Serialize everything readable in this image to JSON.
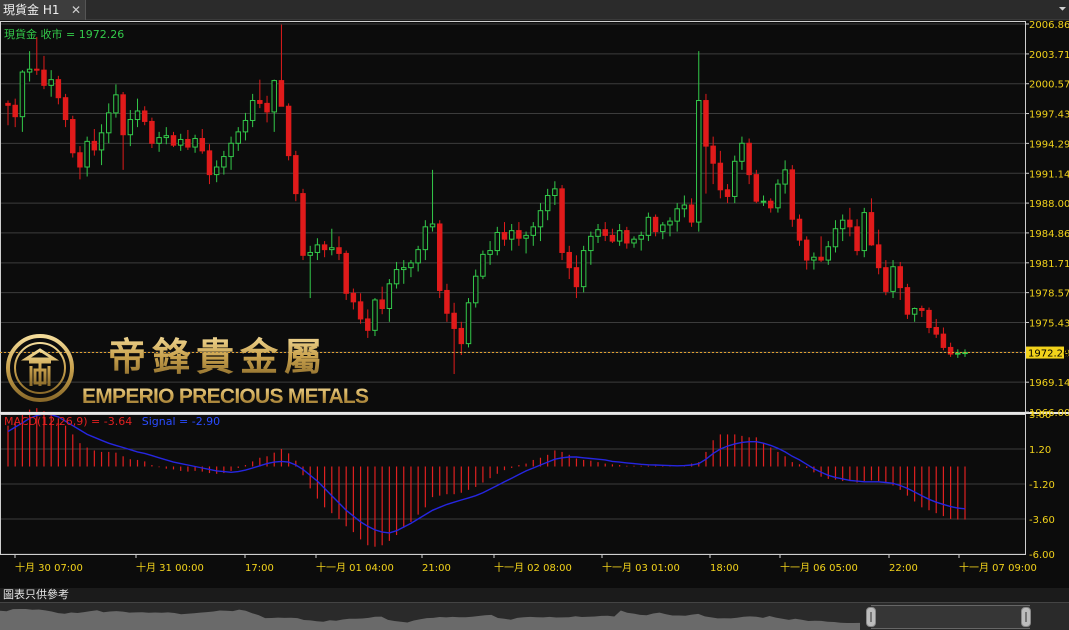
{
  "tab": {
    "title": "現貨金 H1",
    "close_glyph": "✕",
    "menu_glyph": "⏷"
  },
  "price_label": "現貨金 收市 = 1972.26",
  "macd_label": {
    "macd": "MACD(12,26,9) = -3.64",
    "signal": "Signal = -2.90"
  },
  "logo": {
    "chinese": "帝鋒貴金屬",
    "english": "EMPERIO PRECIOUS METALS"
  },
  "last_price": "1972.26",
  "price_ticks": [
    "2006.86",
    "2003.71",
    "2000.57",
    "1997.43",
    "1994.29",
    "1991.14",
    "1988.00",
    "1984.86",
    "1981.71",
    "1978.57",
    "1975.43",
    "1972.29",
    "1969.14",
    "1966.00"
  ],
  "macd_ticks": [
    "3.60",
    "1.20",
    "-1.20",
    "-3.60",
    "-6.00"
  ],
  "time_ticks": [
    "十月 30 07:00",
    "十月 31 00:00",
    "17:00",
    "十一月 01 04:00",
    "21:00",
    "十一月 02 08:00",
    "十一月 03 01:00",
    "18:00",
    "十一月 06 05:00",
    "22:00",
    "十一月 07 09:00"
  ],
  "footer_note": "圖表只供參考",
  "colors": {
    "up": "#33c94a",
    "down": "#e01b1b",
    "price_axis": "#f2d21b",
    "macd_hist": "#e02020",
    "signal": "#2626e0",
    "label_green": "#33c94a",
    "logo_gold": "#c9a95a"
  },
  "chart_data": {
    "type": "candlestick",
    "ylim": [
      1966.0,
      2006.86
    ],
    "macd_ylim": [
      -6.0,
      3.6
    ],
    "last": 1972.26,
    "candles": [
      [
        1998.5,
        1998.8,
        1996.2,
        1998.3
      ],
      [
        1998.3,
        1999.0,
        1996.0,
        1997.1
      ],
      [
        1997.1,
        2002.0,
        1995.5,
        2001.8
      ],
      [
        2001.8,
        2004.0,
        2000.8,
        2002.1
      ],
      [
        2002.1,
        2005.5,
        2001.5,
        2002.0
      ],
      [
        2002.0,
        2003.5,
        2000.0,
        2000.4
      ],
      [
        2000.4,
        2002.0,
        1999.2,
        2001.0
      ],
      [
        2001.0,
        2001.4,
        1998.4,
        1999.1
      ],
      [
        1999.1,
        1999.5,
        1996.0,
        1996.8
      ],
      [
        1996.8,
        1997.2,
        1992.8,
        1993.3
      ],
      [
        1993.3,
        1994.0,
        1990.5,
        1991.8
      ],
      [
        1991.8,
        1995.0,
        1990.8,
        1994.5
      ],
      [
        1994.5,
        1995.8,
        1993.0,
        1993.6
      ],
      [
        1993.6,
        1996.3,
        1992.0,
        1995.4
      ],
      [
        1995.4,
        1998.5,
        1994.3,
        1997.5
      ],
      [
        1997.5,
        2000.5,
        1997.0,
        1999.4
      ],
      [
        1999.4,
        1999.7,
        1991.5,
        1995.2
      ],
      [
        1995.2,
        1997.8,
        1994.0,
        1996.8
      ],
      [
        1996.8,
        1999.0,
        1996.0,
        1997.7
      ],
      [
        1997.7,
        1998.2,
        1996.2,
        1996.6
      ],
      [
        1996.6,
        1997.0,
        1993.8,
        1994.3
      ],
      [
        1994.3,
        1995.5,
        1993.4,
        1994.9
      ],
      [
        1994.9,
        1996.0,
        1994.2,
        1995.1
      ],
      [
        1995.1,
        1995.5,
        1993.9,
        1994.1
      ],
      [
        1994.1,
        1995.3,
        1993.5,
        1994.7
      ],
      [
        1994.7,
        1995.7,
        1993.6,
        1993.9
      ],
      [
        1993.9,
        1995.2,
        1993.3,
        1994.8
      ],
      [
        1994.8,
        1995.8,
        1993.2,
        1993.5
      ],
      [
        1993.5,
        1994.2,
        1990.0,
        1991.0
      ],
      [
        1991.0,
        1992.5,
        1990.2,
        1991.8
      ],
      [
        1991.8,
        1993.5,
        1991.0,
        1992.9
      ],
      [
        1992.9,
        1995.0,
        1991.5,
        1994.3
      ],
      [
        1994.3,
        1996.0,
        1993.5,
        1995.5
      ],
      [
        1995.5,
        1997.5,
        1994.6,
        1996.7
      ],
      [
        1996.7,
        1999.5,
        1996.0,
        1998.8
      ],
      [
        1998.8,
        2001.0,
        1998.0,
        1998.5
      ],
      [
        1998.5,
        1999.3,
        1996.5,
        1997.6
      ],
      [
        1997.6,
        2001.0,
        1995.5,
        2000.9
      ],
      [
        2000.9,
        2006.8,
        1999.6,
        1998.2
      ],
      [
        1998.2,
        1998.5,
        1992.5,
        1993.0
      ],
      [
        1993.0,
        1993.5,
        1988.2,
        1989.0
      ],
      [
        1989.0,
        1989.5,
        1982.0,
        1982.5
      ],
      [
        1982.5,
        1983.5,
        1978.0,
        1982.8
      ],
      [
        1982.8,
        1984.3,
        1982.0,
        1983.6
      ],
      [
        1983.6,
        1984.0,
        1982.3,
        1983.1
      ],
      [
        1983.1,
        1985.3,
        1982.5,
        1983.3
      ],
      [
        1983.3,
        1984.5,
        1982.0,
        1982.7
      ],
      [
        1982.7,
        1983.0,
        1977.8,
        1978.5
      ],
      [
        1978.5,
        1979.0,
        1976.8,
        1977.6
      ],
      [
        1977.6,
        1978.5,
        1975.3,
        1975.8
      ],
      [
        1975.8,
        1976.8,
        1973.8,
        1974.6
      ],
      [
        1974.6,
        1978.0,
        1974.0,
        1977.8
      ],
      [
        1977.8,
        1979.2,
        1976.3,
        1976.9
      ],
      [
        1976.9,
        1980.0,
        1975.5,
        1979.5
      ],
      [
        1979.5,
        1981.8,
        1979.0,
        1981.0
      ],
      [
        1981.0,
        1982.0,
        1979.5,
        1981.2
      ],
      [
        1981.2,
        1982.0,
        1980.2,
        1981.7
      ],
      [
        1981.7,
        1983.5,
        1980.8,
        1983.1
      ],
      [
        1983.1,
        1986.2,
        1982.0,
        1985.5
      ],
      [
        1985.5,
        1991.5,
        1985.0,
        1985.8
      ],
      [
        1985.8,
        1986.2,
        1978.0,
        1978.8
      ],
      [
        1978.8,
        1979.5,
        1975.5,
        1976.4
      ],
      [
        1976.4,
        1977.5,
        1970.0,
        1974.8
      ],
      [
        1974.8,
        1975.5,
        1972.0,
        1973.2
      ],
      [
        1973.2,
        1978.0,
        1972.8,
        1977.5
      ],
      [
        1977.5,
        1981.0,
        1977.0,
        1980.3
      ],
      [
        1980.3,
        1983.0,
        1980.0,
        1982.6
      ],
      [
        1982.6,
        1984.0,
        1981.5,
        1983.0
      ],
      [
        1983.0,
        1985.5,
        1982.5,
        1984.9
      ],
      [
        1984.9,
        1986.0,
        1983.5,
        1984.2
      ],
      [
        1984.2,
        1985.8,
        1983.0,
        1985.1
      ],
      [
        1985.1,
        1986.0,
        1983.5,
        1984.3
      ],
      [
        1984.3,
        1985.0,
        1982.7,
        1984.6
      ],
      [
        1984.6,
        1986.0,
        1983.5,
        1985.5
      ],
      [
        1985.5,
        1988.0,
        1984.0,
        1987.2
      ],
      [
        1987.2,
        1989.5,
        1986.2,
        1988.8
      ],
      [
        1988.8,
        1990.3,
        1987.8,
        1989.5
      ],
      [
        1989.5,
        1989.9,
        1982.0,
        1982.8
      ],
      [
        1982.8,
        1983.5,
        1980.0,
        1981.2
      ],
      [
        1981.2,
        1982.5,
        1978.0,
        1979.2
      ],
      [
        1979.2,
        1983.5,
        1978.6,
        1983.0
      ],
      [
        1983.0,
        1985.0,
        1981.5,
        1984.5
      ],
      [
        1984.5,
        1985.8,
        1983.8,
        1985.2
      ],
      [
        1985.2,
        1986.0,
        1984.0,
        1984.6
      ],
      [
        1984.6,
        1985.3,
        1983.8,
        1984.0
      ],
      [
        1984.0,
        1985.8,
        1983.5,
        1985.1
      ],
      [
        1985.1,
        1985.5,
        1983.2,
        1983.8
      ],
      [
        1983.8,
        1984.5,
        1983.3,
        1984.2
      ],
      [
        1984.2,
        1985.0,
        1983.0,
        1984.6
      ],
      [
        1984.6,
        1987.0,
        1984.0,
        1986.5
      ],
      [
        1986.5,
        1986.8,
        1984.5,
        1985.0
      ],
      [
        1985.0,
        1986.0,
        1984.2,
        1985.7
      ],
      [
        1985.7,
        1986.5,
        1984.5,
        1986.1
      ],
      [
        1986.1,
        1988.0,
        1985.0,
        1987.4
      ],
      [
        1987.4,
        1988.8,
        1986.5,
        1987.8
      ],
      [
        1987.8,
        1988.5,
        1985.5,
        1986.0
      ],
      [
        1986.0,
        2004.0,
        1985.0,
        1998.8
      ],
      [
        1998.8,
        1999.5,
        1989.0,
        1994.0
      ],
      [
        1994.0,
        1995.0,
        1990.0,
        1992.2
      ],
      [
        1992.2,
        1993.5,
        1988.5,
        1989.4
      ],
      [
        1989.4,
        1990.0,
        1988.0,
        1988.7
      ],
      [
        1988.7,
        1993.0,
        1988.0,
        1992.4
      ],
      [
        1992.4,
        1995.0,
        1991.5,
        1994.3
      ],
      [
        1994.3,
        1994.8,
        1990.0,
        1991.0
      ],
      [
        1991.0,
        1991.5,
        1988.0,
        1988.2
      ],
      [
        1988.2,
        1988.8,
        1987.7,
        1988.2
      ],
      [
        1988.2,
        1988.5,
        1987.0,
        1987.5
      ],
      [
        1987.5,
        1990.5,
        1987.0,
        1990.0
      ],
      [
        1990.0,
        1992.5,
        1989.0,
        1991.5
      ],
      [
        1991.5,
        1992.0,
        1985.5,
        1986.3
      ],
      [
        1986.3,
        1986.8,
        1983.5,
        1984.1
      ],
      [
        1984.1,
        1984.5,
        1981.0,
        1982.0
      ],
      [
        1982.0,
        1982.8,
        1981.0,
        1982.3
      ],
      [
        1982.3,
        1984.5,
        1981.8,
        1982.0
      ],
      [
        1982.0,
        1984.0,
        1981.5,
        1983.4
      ],
      [
        1983.4,
        1986.2,
        1982.8,
        1985.3
      ],
      [
        1985.3,
        1986.8,
        1984.0,
        1986.2
      ],
      [
        1986.2,
        1987.5,
        1984.5,
        1985.5
      ],
      [
        1985.5,
        1986.3,
        1982.5,
        1983.0
      ],
      [
        1983.0,
        1987.5,
        1982.3,
        1987.0
      ],
      [
        1987.0,
        1988.5,
        1983.5,
        1983.6
      ],
      [
        1983.6,
        1985.2,
        1980.5,
        1981.2
      ],
      [
        1981.2,
        1982.0,
        1978.3,
        1978.7
      ],
      [
        1978.7,
        1982.0,
        1978.0,
        1981.3
      ],
      [
        1981.3,
        1981.8,
        1977.8,
        1979.1
      ],
      [
        1979.1,
        1979.5,
        1975.8,
        1976.3
      ],
      [
        1976.3,
        1977.0,
        1975.5,
        1976.9
      ],
      [
        1976.9,
        1977.2,
        1976.0,
        1976.7
      ],
      [
        1976.7,
        1977.0,
        1974.3,
        1974.9
      ],
      [
        1974.9,
        1975.8,
        1973.8,
        1974.2
      ],
      [
        1974.2,
        1974.9,
        1972.5,
        1972.8
      ],
      [
        1972.8,
        1973.3,
        1971.8,
        1972.1
      ],
      [
        1972.1,
        1972.6,
        1971.7,
        1972.2
      ],
      [
        1972.2,
        1972.6,
        1971.8,
        1972.26
      ]
    ],
    "macd_hist": [
      2.8,
      3.0,
      3.6,
      3.9,
      4.0,
      3.8,
      3.6,
      3.3,
      2.8,
      2.2,
      1.6,
      1.3,
      1.1,
      1.0,
      1.0,
      0.95,
      0.7,
      0.5,
      0.45,
      0.35,
      0.1,
      -0.05,
      -0.15,
      -0.2,
      -0.3,
      -0.35,
      -0.3,
      -0.35,
      -0.45,
      -0.5,
      -0.45,
      -0.3,
      -0.1,
      0.1,
      0.35,
      0.6,
      0.7,
      0.95,
      1.2,
      0.9,
      0.4,
      -0.6,
      -1.5,
      -2.2,
      -2.8,
      -3.2,
      -3.6,
      -4.1,
      -4.5,
      -5.0,
      -5.4,
      -5.5,
      -5.4,
      -5.1,
      -4.7,
      -4.2,
      -3.8,
      -3.3,
      -2.8,
      -2.1,
      -2.0,
      -1.9,
      -1.9,
      -1.8,
      -1.6,
      -1.4,
      -1.1,
      -0.8,
      -0.5,
      -0.25,
      -0.1,
      0.1,
      0.2,
      0.45,
      0.6,
      0.8,
      1.1,
      1.0,
      0.8,
      0.55,
      0.45,
      0.4,
      0.3,
      0.2,
      0.15,
      0.1,
      0.05,
      0.05,
      0.05,
      0.05,
      0.05,
      0.05,
      0.05,
      0.05,
      0.1,
      0.2,
      0.3,
      1.0,
      1.8,
      2.2,
      2.2,
      2.2,
      2.1,
      2.0,
      2.0,
      1.6,
      1.3,
      1.0,
      0.7,
      0.3,
      0.15,
      -0.1,
      -0.4,
      -0.7,
      -0.85,
      -0.9,
      -1.0,
      -1.0,
      -1.1,
      -1.0,
      -0.95,
      -1.0,
      -1.1,
      -1.3,
      -1.6,
      -2.0,
      -2.4,
      -2.8,
      -3.0,
      -3.2,
      -3.4,
      -3.6,
      -3.64,
      -3.64
    ],
    "signal": [
      2.4,
      2.7,
      3.0,
      3.3,
      3.5,
      3.6,
      3.55,
      3.4,
      3.1,
      2.8,
      2.5,
      2.2,
      2.0,
      1.8,
      1.6,
      1.45,
      1.3,
      1.15,
      1.0,
      0.9,
      0.75,
      0.6,
      0.45,
      0.3,
      0.2,
      0.1,
      0.0,
      -0.1,
      -0.2,
      -0.3,
      -0.35,
      -0.4,
      -0.35,
      -0.25,
      -0.1,
      0.05,
      0.2,
      0.3,
      0.35,
      0.3,
      0.1,
      -0.2,
      -0.6,
      -1.0,
      -1.5,
      -2.0,
      -2.5,
      -3.0,
      -3.4,
      -3.8,
      -4.1,
      -4.35,
      -4.5,
      -4.55,
      -4.4,
      -4.15,
      -3.9,
      -3.6,
      -3.3,
      -3.0,
      -2.8,
      -2.6,
      -2.45,
      -2.3,
      -2.15,
      -2.0,
      -1.8,
      -1.55,
      -1.3,
      -1.05,
      -0.8,
      -0.55,
      -0.3,
      -0.1,
      0.1,
      0.3,
      0.5,
      0.6,
      0.65,
      0.65,
      0.6,
      0.55,
      0.5,
      0.45,
      0.35,
      0.3,
      0.25,
      0.2,
      0.15,
      0.12,
      0.1,
      0.08,
      0.06,
      0.05,
      0.06,
      0.1,
      0.2,
      0.5,
      0.9,
      1.2,
      1.4,
      1.55,
      1.65,
      1.7,
      1.7,
      1.6,
      1.45,
      1.25,
      1.0,
      0.7,
      0.45,
      0.15,
      -0.15,
      -0.4,
      -0.6,
      -0.75,
      -0.85,
      -0.95,
      -1.0,
      -1.05,
      -1.05,
      -1.05,
      -1.1,
      -1.15,
      -1.3,
      -1.5,
      -1.75,
      -2.0,
      -2.25,
      -2.45,
      -2.6,
      -2.75,
      -2.85,
      -2.9
    ]
  }
}
